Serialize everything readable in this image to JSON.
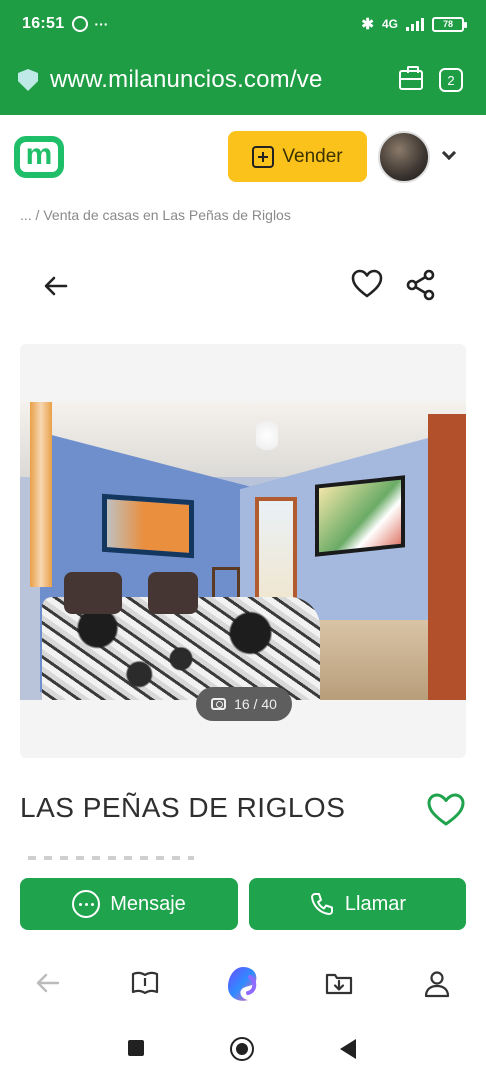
{
  "status_bar": {
    "time": "16:51",
    "extra": "···",
    "battery": "78",
    "network": "4G"
  },
  "browser": {
    "url": "www.milanuncios.com/ve",
    "tabs_count": "2"
  },
  "header": {
    "logo": "m",
    "sell_button": "Vender"
  },
  "breadcrumb": "... / Venta de casas en Las Peñas de Riglos",
  "gallery": {
    "counter": "16 / 40"
  },
  "listing": {
    "title": "LAS PEÑAS DE RIGLOS"
  },
  "actions": {
    "message_label": "Mensaje",
    "call_label": "Llamar"
  },
  "colors": {
    "brand_green": "#1fa34c",
    "sell_yellow": "#fbc21c",
    "logo_green": "#1fbf6a"
  }
}
